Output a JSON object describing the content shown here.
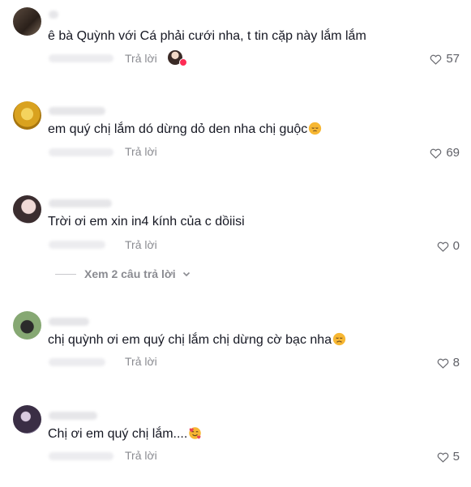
{
  "reply_label": "Trả lời",
  "comments": [
    {
      "text": "ê bà Quỳnh với Cá phải cưới nha, t tin cặp này lắm lắm",
      "likes": "57",
      "emoji": "",
      "liked_by_creator": true
    },
    {
      "text": "em quý chị lắm dó dừng dỏ den nha chị guộc",
      "likes": "69",
      "emoji": "pensive-face"
    },
    {
      "text": "Trời ơi em xin in4 kính của c dồiisi",
      "likes": "0",
      "emoji": ""
    },
    {
      "text": "chị quỳnh ơi em quý chị lắm chị dừng cờ bạc nha",
      "likes": "8",
      "emoji": "disappointed-face"
    },
    {
      "text": "Chị ơi em quý chị lắm....",
      "likes": "5",
      "emoji": "smiling-face-with-hearts"
    }
  ],
  "view_replies": {
    "label": "Xem 2 câu trả lời"
  },
  "icons": {
    "like": "heart-outline-icon",
    "expand": "chevron-down-icon"
  },
  "colors": {
    "text": "#161823",
    "secondary": "#8a8b91",
    "accent": "#fe2c55"
  }
}
